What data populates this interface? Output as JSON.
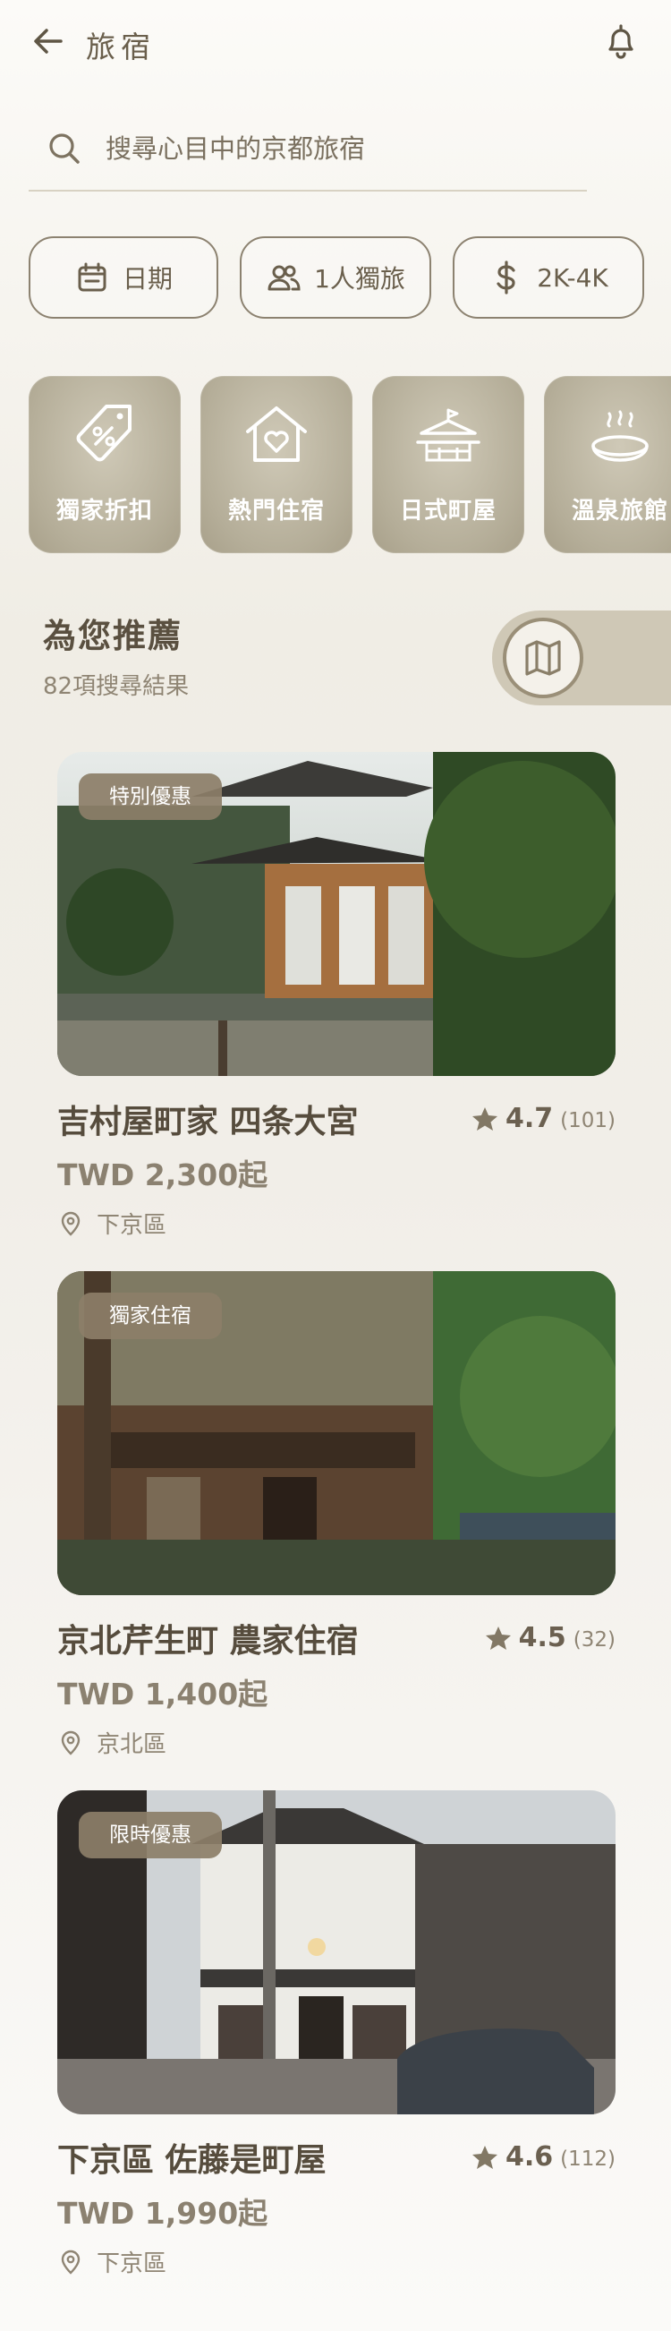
{
  "header": {
    "title": "旅宿"
  },
  "search": {
    "placeholder": "搜尋心目中的京都旅宿"
  },
  "filters": [
    {
      "icon": "calendar-icon",
      "label": "日期"
    },
    {
      "icon": "people-icon",
      "label": "1人獨旅"
    },
    {
      "icon": "dollar-icon",
      "label": "2K-4K"
    }
  ],
  "categories": [
    {
      "icon": "discount-tag-icon",
      "label": "獨家折扣"
    },
    {
      "icon": "house-heart-icon",
      "label": "熱門住宿"
    },
    {
      "icon": "machiya-icon",
      "label": "日式町屋"
    },
    {
      "icon": "onsen-icon",
      "label": "溫泉旅館"
    }
  ],
  "section": {
    "title": "為您推薦",
    "subtitle": "82項搜尋結果"
  },
  "listings": [
    {
      "badge": "特別優惠",
      "name": "吉村屋町家 四条大宮",
      "score": "4.7",
      "count": "(101)",
      "price": "TWD 2,300起",
      "district": "下京區"
    },
    {
      "badge": "獨家住宿",
      "name": "京北芹生町 農家住宿",
      "score": "4.5",
      "count": "(32)",
      "price": "TWD 1,400起",
      "district": "京北區"
    },
    {
      "badge": "限時優惠",
      "name": "下京區 佐藤是町屋",
      "score": "4.6",
      "count": "(112)",
      "price": "TWD 1,990起",
      "district": "下京區"
    }
  ],
  "colors": {
    "accent": "#8c7e68",
    "text": "#564c3d",
    "tile": "#b5ae99"
  }
}
